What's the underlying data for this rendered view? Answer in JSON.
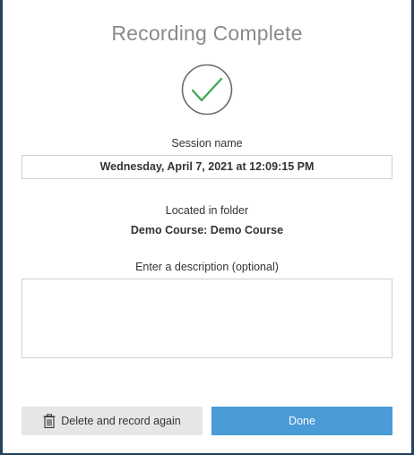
{
  "dialog": {
    "title": "Recording Complete",
    "status_icon": "checkmark-circle-icon",
    "session_name_label": "Session name",
    "session_name_value": "Wednesday, April 7, 2021 at 12:09:15 PM",
    "folder_label": "Located in folder",
    "folder_value": "Demo Course: Demo Course",
    "description_label": "Enter a description (optional)",
    "description_value": ""
  },
  "buttons": {
    "delete_label": "Delete and record again",
    "delete_icon": "trash-icon",
    "done_label": "Done"
  },
  "colors": {
    "check_green": "#3aa84b",
    "done_blue": "#4a9bd6",
    "delete_gray": "#e6e6e6"
  }
}
